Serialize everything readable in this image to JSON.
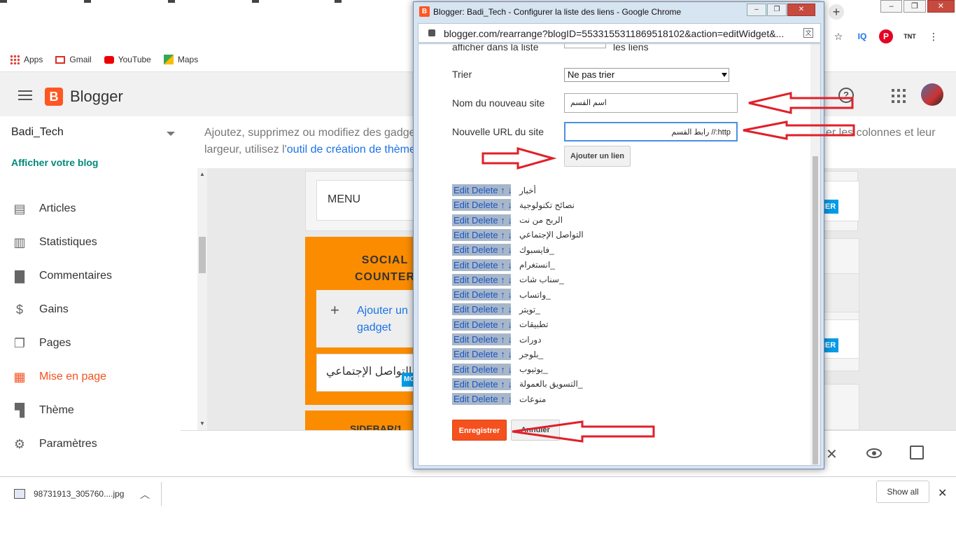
{
  "browser": {
    "bookmarks": [
      {
        "label": "Apps",
        "icon": "apps-grid-icon"
      },
      {
        "label": "Gmail",
        "icon": "gmail-icon"
      },
      {
        "label": "YouTube",
        "icon": "youtube-icon"
      },
      {
        "label": "Maps",
        "icon": "maps-icon"
      }
    ],
    "extensions_icons": [
      "star-icon",
      "iq-icon",
      "pinterest-icon",
      "tnt-icon",
      "menu-dots-icon"
    ]
  },
  "header": {
    "app_name": "Blogger",
    "help_icon": "help-icon",
    "apps_icon": "apps-grid-icon"
  },
  "sidebar": {
    "blog_name": "Badi_Tech",
    "view_blog": "Afficher votre blog",
    "items": [
      {
        "label": "Articles",
        "icon": "articles-icon"
      },
      {
        "label": "Statistiques",
        "icon": "stats-icon"
      },
      {
        "label": "Commentaires",
        "icon": "comments-icon"
      },
      {
        "label": "Gains",
        "icon": "dollar-icon"
      },
      {
        "label": "Pages",
        "icon": "pages-icon"
      },
      {
        "label": "Mise en page",
        "icon": "layout-icon",
        "active": true
      },
      {
        "label": "Thème",
        "icon": "theme-icon"
      },
      {
        "label": "Paramètres",
        "icon": "gear-icon"
      }
    ]
  },
  "main": {
    "intro_prefix": "Ajoutez, supprimez ou modifiez des gadge",
    "intro_line2_prefix": "largeur, utilisez l'",
    "intro_link": "outil de création de thème",
    "intro_right": "er les colonnes et leur",
    "menu_label": "MENU",
    "social_title": "SOCIAL COUNTER",
    "add_gadget": "Ajouter un gadget",
    "gadget_arabic": "مواقع التواصل الإجتماعي",
    "sidebar1_label": "SIDEBAR/1",
    "badge_text": "MO",
    "badge_right": "IER"
  },
  "download": {
    "file_name": "98731913_305760....jpg",
    "show_all": "Show all"
  },
  "popup": {
    "window_title": "Blogger: Badi_Tech - Configurer la liste des liens - Google Chrome",
    "url": "blogger.com/rearrange?blogID=5533155311869518102&action=editWidget&...",
    "cut_label": "afficher dans la liste",
    "cut_suffix": "les liens",
    "sort_label": "Trier",
    "sort_value": "Ne pas trier",
    "new_site_label": "Nom du nouveau site",
    "new_site_value": "اسم القسم",
    "new_url_label": "Nouvelle URL du site",
    "new_url_value": "http:// رابط القسم",
    "add_link_button": "Ajouter un lien",
    "row_controls": "Edit Delete ↑ ↓",
    "links": [
      "أخبار",
      "نصائح تكنولوجية",
      "الربح من نت",
      "التواصل الإجتماعي",
      "_فايسبوك",
      "_انستغرام",
      "_سناب شات",
      "_واتساب",
      "_تويتر",
      "تطبيقات",
      "دورات",
      "_بلوجر",
      "_يوتيوب",
      "_التسويق بالعمولة",
      "منوعات"
    ],
    "save_button": "Enregistrer",
    "cancel_button": "Annuler",
    "annotation_color": "#e0202a"
  }
}
